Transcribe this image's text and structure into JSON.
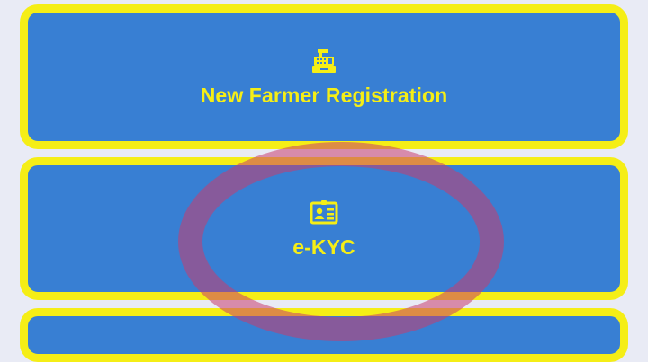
{
  "menu": {
    "items": [
      {
        "label": "New Farmer Registration",
        "icon": "cash-register-icon"
      },
      {
        "label": "e-KYC",
        "icon": "id-card-icon"
      }
    ]
  },
  "colors": {
    "page_background": "#e9ebf5",
    "card_background": "#387fd3",
    "card_border": "#f5ee16",
    "label_text": "#f5ee16",
    "highlight_annotation": "#c83c6e"
  }
}
